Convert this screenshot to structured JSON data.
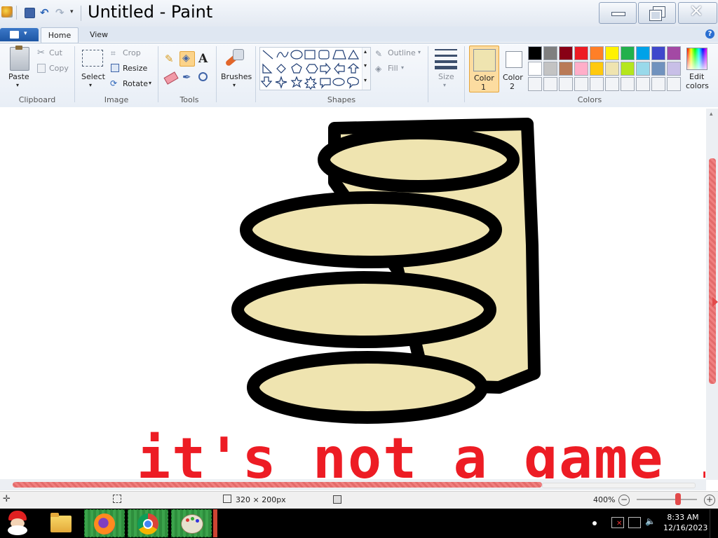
{
  "window": {
    "title": "Untitled - Paint"
  },
  "ribbon": {
    "tabs": [
      "Home",
      "View"
    ],
    "clipboard": {
      "paste": "Paste",
      "cut": "Cut",
      "copy": "Copy",
      "group_label": "Clipboard"
    },
    "image": {
      "select": "Select",
      "crop": "Crop",
      "resize": "Resize",
      "rotate": "Rotate",
      "group_label": "Image"
    },
    "tools": {
      "group_label": "Tools"
    },
    "brushes": {
      "label": "Brushes"
    },
    "shapes": {
      "outline": "Outline",
      "fill": "Fill",
      "group_label": "Shapes"
    },
    "size": {
      "label": "Size"
    },
    "colors": {
      "color1_label": "Color",
      "color1_num": "1",
      "color2_label": "Color",
      "color2_num": "2",
      "edit_label": "Edit",
      "edit_label2": "colors",
      "group_label": "Colors",
      "color1_value": "#efe4b0",
      "color2_value": "#ffffff",
      "palette_row1": [
        "#000000",
        "#7f7f7f",
        "#880015",
        "#ed1c24",
        "#ff7f27",
        "#fff200",
        "#22b14c",
        "#00a2e8",
        "#3f48cc",
        "#a349a4"
      ],
      "palette_row2": [
        "#ffffff",
        "#c3c3c3",
        "#b97a57",
        "#ffaec9",
        "#ffc90e",
        "#efe4b0",
        "#b5e61d",
        "#99d9ea",
        "#7092be",
        "#c8bfe7"
      ],
      "palette_row3": [
        "#f2f4f7",
        "#f2f4f7",
        "#f2f4f7",
        "#f2f4f7",
        "#f2f4f7",
        "#f2f4f7",
        "#f2f4f7",
        "#f2f4f7",
        "#f2f4f7",
        "#f2f4f7"
      ]
    }
  },
  "canvas": {
    "text": "it's not a game in vo",
    "drawing_fill": "#efe4b0",
    "text_color": "#ed1c24"
  },
  "statusbar": {
    "dimensions": "320 × 200px",
    "zoom": "400%"
  },
  "taskbar": {
    "time": "8:33 AM",
    "date": "12/16/2023"
  }
}
